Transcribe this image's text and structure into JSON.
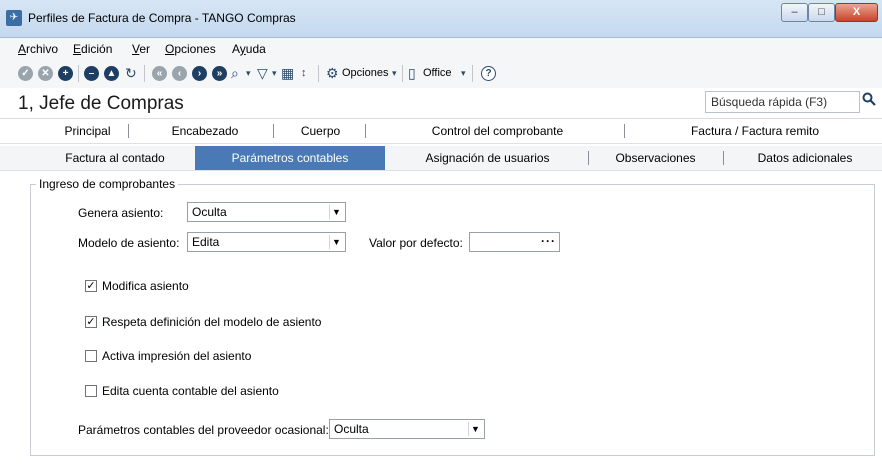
{
  "window": {
    "title": "Perfiles de Factura de Compra - TANGO Compras",
    "minimize": "–",
    "maximize": "□",
    "close": "X"
  },
  "menu": [
    {
      "accel": "A",
      "rest": "rchivo"
    },
    {
      "accel": "E",
      "rest": "dición"
    },
    {
      "accel": "V",
      "rest": "er"
    },
    {
      "accel": "O",
      "rest": "pciones"
    },
    {
      "pre": "A",
      "accel": "y",
      "rest": "uda"
    }
  ],
  "toolbar": {
    "opciones_label": "Opciones",
    "office_label": "Office",
    "help": "?"
  },
  "header": {
    "title": "1, Jefe de Compras",
    "search_placeholder": "Búsqueda rápida (F3)"
  },
  "tabs_row1": [
    "Principal",
    "Encabezado",
    "Cuerpo",
    "Control del comprobante",
    "Factura / Factura remito"
  ],
  "tabs_row2": [
    "Factura al contado",
    "Parámetros contables",
    "Asignación de usuarios",
    "Observaciones",
    "Datos adicionales"
  ],
  "form": {
    "group_title": "Ingreso de comprobantes",
    "genera_asiento_label": "Genera asiento:",
    "genera_asiento_value": "Oculta",
    "modelo_asiento_label": "Modelo de asiento:",
    "modelo_asiento_value": "Edita",
    "valor_defecto_label": "Valor por defecto:",
    "valor_defecto_value": "",
    "ellipsis": "···",
    "checkboxes": [
      {
        "label": "Modifica asiento",
        "checked": true
      },
      {
        "label": "Respeta definición del modelo de asiento",
        "checked": true
      },
      {
        "label": "Activa impresión del asiento",
        "checked": false
      },
      {
        "label": "Edita cuenta contable del asiento",
        "checked": false
      }
    ],
    "proveedor_label": "Parámetros contables del proveedor ocasional:",
    "proveedor_value": "Oculta"
  }
}
